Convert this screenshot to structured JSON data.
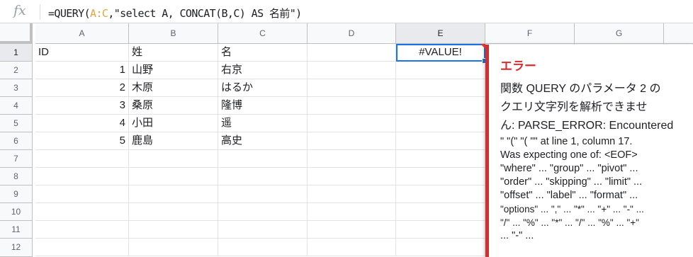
{
  "formula_bar": {
    "fx_label": "fx",
    "prefix": "=QUERY(",
    "range": "A:C",
    "suffix": ",\"select A, CONCAT(B,C) AS 名前\")"
  },
  "columns": [
    "A",
    "B",
    "C",
    "D",
    "E",
    "F",
    "G"
  ],
  "rows": [
    "1",
    "2",
    "3",
    "4",
    "5",
    "6",
    "7",
    "8",
    "9",
    "10",
    "11",
    "12"
  ],
  "cells": {
    "header": {
      "a": "ID",
      "b": "姓",
      "c": "名",
      "e": "#VALUE!"
    },
    "data": [
      {
        "id": "1",
        "sei": "山野",
        "mei": "右京"
      },
      {
        "id": "2",
        "sei": "木原",
        "mei": "はるか"
      },
      {
        "id": "3",
        "sei": "桑原",
        "mei": "隆博"
      },
      {
        "id": "4",
        "sei": "小田",
        "mei": "遥"
      },
      {
        "id": "5",
        "sei": "鹿島",
        "mei": "高史"
      }
    ]
  },
  "error": {
    "title": "エラー",
    "line1": "関数 QUERY のパラメータ 2 の",
    "line2": "クエリ文字列を解析できませ",
    "line3": "ん: PARSE_ERROR: Encountered",
    "line4": "\" \"(\" \"( \"\" at line 1, column 17.",
    "line5": "Was expecting one of: <EOF>",
    "line6": "\"where\" ... \"group\" ... \"pivot\" ...",
    "line7": "\"order\" ... \"skipping\" ... \"limit\" ...",
    "line8": "\"offset\" ... \"label\" ... \"format\" ...",
    "line9": "\"options\" ... \",\" ... \"*\" ... \"+\" ... \"-\" ...",
    "line10": "\"/\" ... \"%\" ... \"*\" ... \"/\" ... \"%\" ... \"+\"",
    "line11": "... \"-\" ..."
  },
  "colors": {
    "accent": "#1a73e8",
    "error": "#d32f2f",
    "range_ref": "#e8a33a"
  }
}
